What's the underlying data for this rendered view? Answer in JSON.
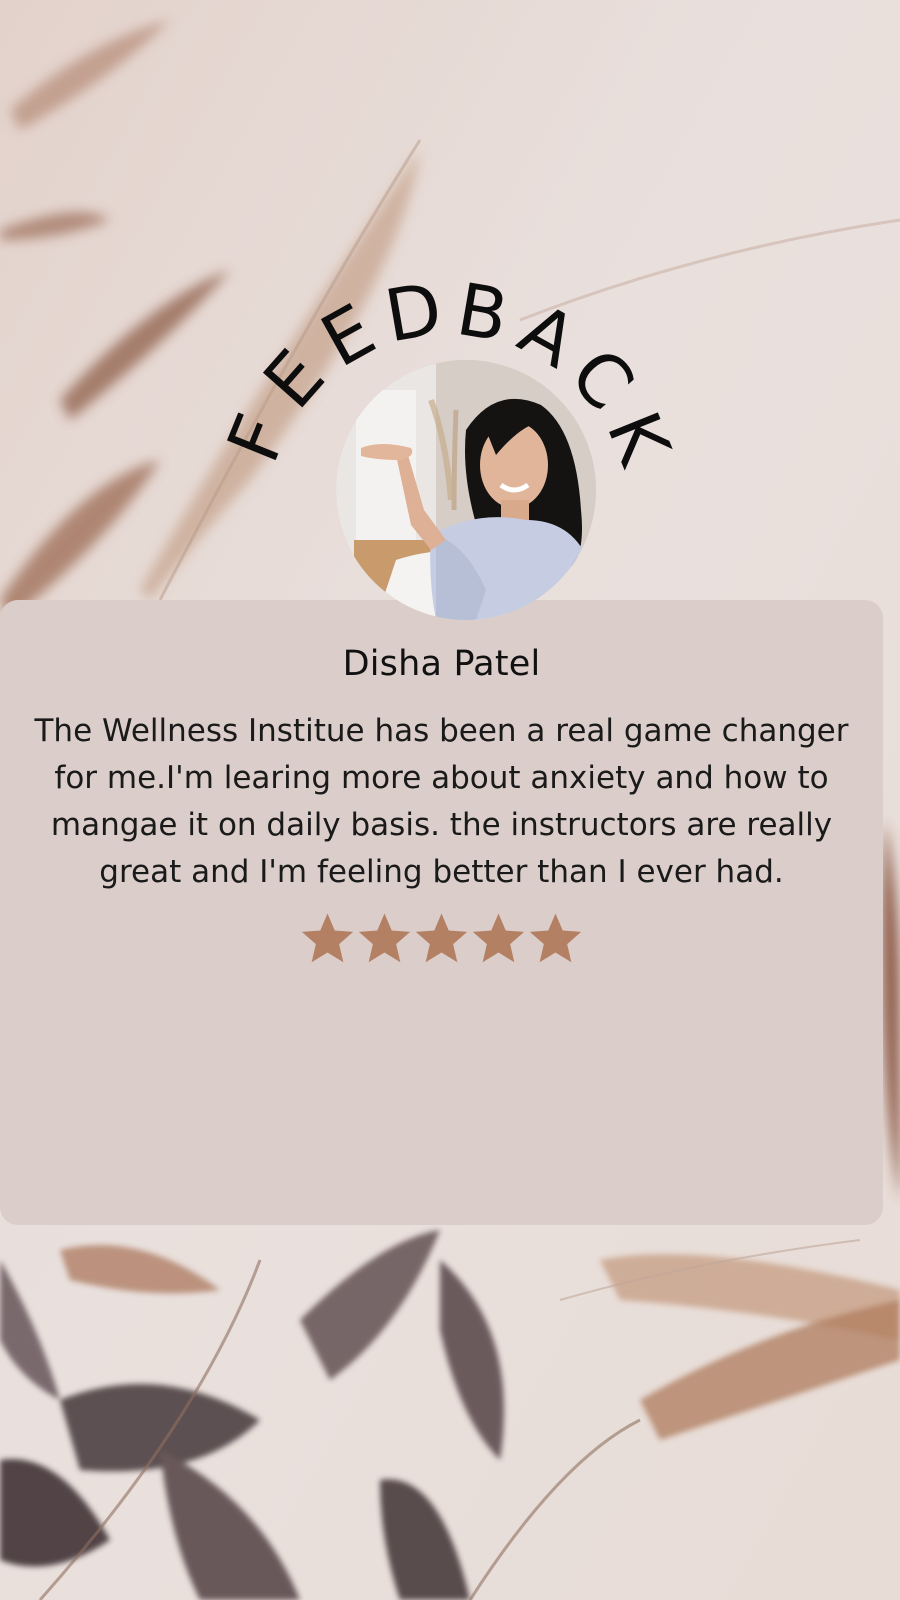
{
  "header": {
    "title": "FEEDBACK"
  },
  "testimonial": {
    "name": "Disha Patel",
    "review_lines": [
      "The Wellness Institue has been a real game changer",
      "for me.I'm learing more about anxiety and how to",
      "mangae it on daily basis. the instructors are really",
      "great and I'm feeling better than I ever had."
    ],
    "rating": 5,
    "rating_max": 5
  },
  "colors": {
    "card": "#dbceca",
    "star": "#b48063",
    "title": "#0d0d0d",
    "text": "#1a1a1a"
  }
}
